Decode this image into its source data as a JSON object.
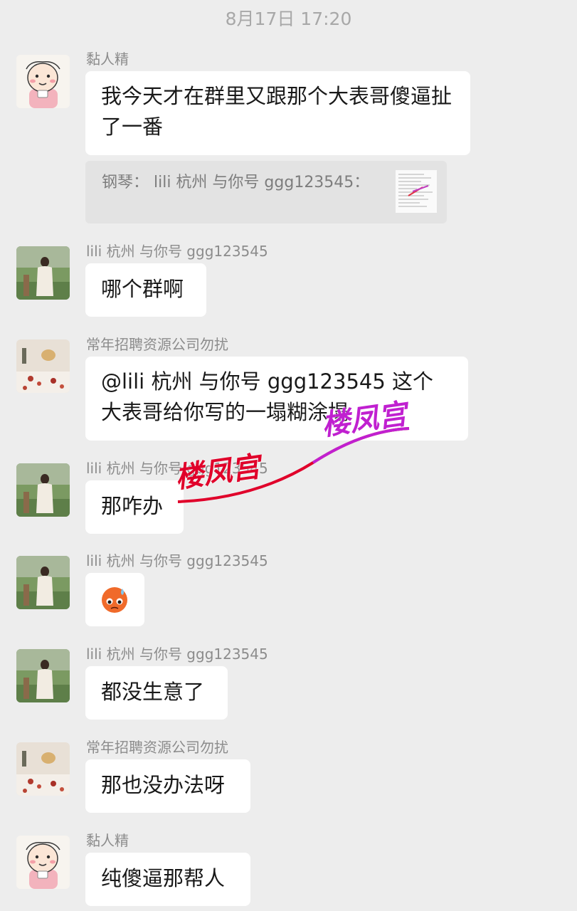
{
  "timestamp": "8月17日 17:20",
  "messages": [
    {
      "sender": "黏人精",
      "text": "我今天才在群里又跟那个大表哥傻逼扯了一番",
      "avatar": "cartoon-avatar"
    },
    {
      "sender": "lili 杭州 与你号 ggg123545",
      "text": "哪个群啊",
      "avatar": "girl-photo-avatar"
    },
    {
      "sender": "常年招聘资源公司勿扰",
      "text": "@lili 杭州 与你号 ggg123545 这个大表哥给你写的一塌糊涂塌",
      "avatar": "flowers-photo-avatar"
    },
    {
      "sender": "lili 杭州 与你号 ggg123545",
      "text": "那咋办",
      "avatar": "girl-photo-avatar"
    },
    {
      "sender": "lili 杭州 与你号 ggg123545",
      "text": "",
      "sticker": "sweating-face-emoji",
      "avatar": "girl-photo-avatar"
    },
    {
      "sender": "lili 杭州 与你号 ggg123545",
      "text": "都没生意了",
      "avatar": "girl-photo-avatar"
    },
    {
      "sender": "常年招聘资源公司勿扰",
      "text": "那也没办法呀",
      "avatar": "flowers-photo-avatar"
    },
    {
      "sender": "黏人精",
      "text": "纯傻逼那帮人",
      "avatar": "cartoon-avatar"
    }
  ],
  "quote": {
    "text": "钢琴： lili 杭州 与你号 ggg123545："
  },
  "watermark": {
    "text_1": "楼凤宫",
    "text_2": "楼凤宫",
    "colors": [
      "#e0002a",
      "#c020d0"
    ]
  }
}
